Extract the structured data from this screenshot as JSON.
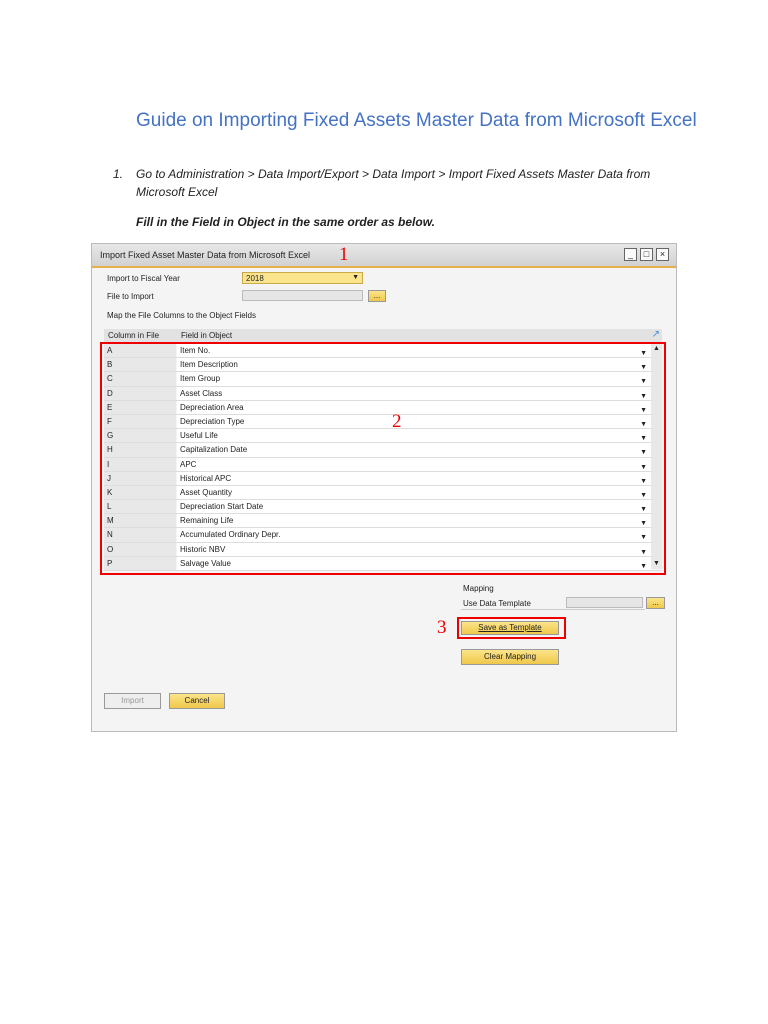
{
  "doc": {
    "title": "Guide on Importing Fixed Assets Master Data from Microsoft Excel",
    "step_number": "1.",
    "step_text": "Go to Administration > Data Import/Export > Data Import > Import Fixed Assets Master Data from Microsoft Excel",
    "note": "Fill in the Field in Object in the same order as below."
  },
  "window": {
    "title": "Import Fixed Asset Master Data from Microsoft Excel",
    "fiscal_year_label": "Import to Fiscal Year",
    "fiscal_year_value": "2018",
    "file_label": "File to Import",
    "browse": "...",
    "map_label": "Map the File Columns to the Object Fields",
    "col_header": "Column in File",
    "field_header": "Field in Object",
    "rows": [
      {
        "c": "A",
        "f": "Item No."
      },
      {
        "c": "B",
        "f": "Item Description"
      },
      {
        "c": "C",
        "f": "Item Group"
      },
      {
        "c": "D",
        "f": "Asset Class"
      },
      {
        "c": "E",
        "f": "Depreciation Area"
      },
      {
        "c": "F",
        "f": "Depreciation Type"
      },
      {
        "c": "G",
        "f": "Useful Life"
      },
      {
        "c": "H",
        "f": "Capitalization Date"
      },
      {
        "c": "I",
        "f": "APC"
      },
      {
        "c": "J",
        "f": "Historical APC"
      },
      {
        "c": "K",
        "f": "Asset Quantity"
      },
      {
        "c": "L",
        "f": "Depreciation Start Date"
      },
      {
        "c": "M",
        "f": "Remaining Life"
      },
      {
        "c": "N",
        "f": "Accumulated Ordinary Depr."
      },
      {
        "c": "O",
        "f": "Historic NBV"
      },
      {
        "c": "P",
        "f": "Salvage Value"
      }
    ],
    "mapping_label": "Mapping",
    "use_template_label": "Use Data Template",
    "save_template": "Save as Template",
    "clear_mapping": "Clear Mapping",
    "import": "Import",
    "cancel": "Cancel"
  },
  "annotations": [
    "1",
    "2",
    "3"
  ]
}
